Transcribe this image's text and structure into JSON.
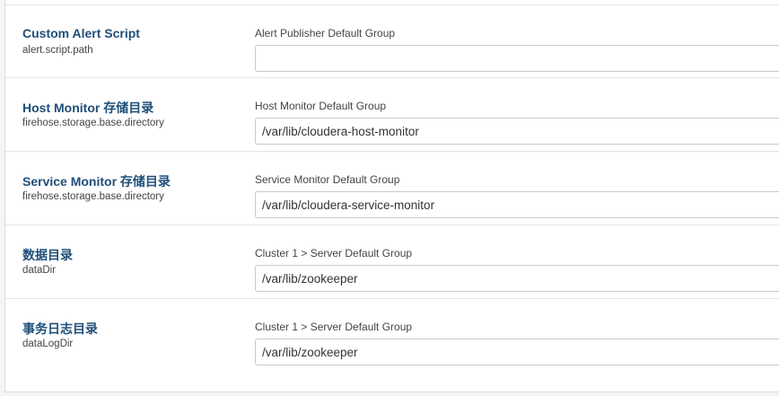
{
  "config_rows": [
    {
      "title": "Custom Alert Script",
      "key": "alert.script.path",
      "group": "Alert Publisher Default Group",
      "value": ""
    },
    {
      "title": "Host Monitor 存储目录",
      "key": "firehose.storage.base.directory",
      "group": "Host Monitor Default Group",
      "value": "/var/lib/cloudera-host-monitor"
    },
    {
      "title": "Service Monitor 存储目录",
      "key": "firehose.storage.base.directory",
      "group": "Service Monitor Default Group",
      "value": "/var/lib/cloudera-service-monitor"
    },
    {
      "title": "数据目录",
      "key": "dataDir",
      "group": "Cluster 1 > Server Default Group",
      "value": "/var/lib/zookeeper"
    },
    {
      "title": "事务日志目录",
      "key": "dataLogDir",
      "group": "Cluster 1 > Server Default Group",
      "value": "/var/lib/zookeeper"
    }
  ]
}
